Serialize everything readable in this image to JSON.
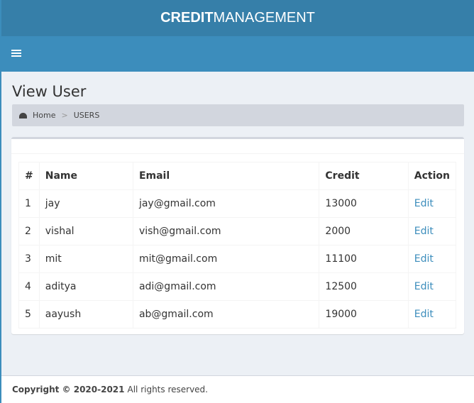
{
  "header": {
    "brand_bold": "CREDIT",
    "brand_rest": "MANAGEMENT"
  },
  "page": {
    "title": "View User"
  },
  "breadcrumb": {
    "home": "Home",
    "separator": ">",
    "current": "USERS"
  },
  "table": {
    "columns": [
      "#",
      "Name",
      "Email",
      "Credit",
      "Action"
    ],
    "rows": [
      {
        "id": "1",
        "name": "jay",
        "email": "jay@gmail.com",
        "credit": "13000",
        "action": "Edit"
      },
      {
        "id": "2",
        "name": "vishal",
        "email": "vish@gmail.com",
        "credit": "2000",
        "action": "Edit"
      },
      {
        "id": "3",
        "name": "mit",
        "email": "mit@gmail.com",
        "credit": "11100",
        "action": "Edit"
      },
      {
        "id": "4",
        "name": "aditya",
        "email": "adi@gmail.com",
        "credit": "12500",
        "action": "Edit"
      },
      {
        "id": "5",
        "name": "aayush",
        "email": "ab@gmail.com",
        "credit": "19000",
        "action": "Edit"
      }
    ]
  },
  "footer": {
    "copyright": "Copyright © 2020-2021",
    "rights": "All rights reserved."
  },
  "colors": {
    "header_dark": "#367fa9",
    "header": "#3c8dbc",
    "link": "#3c8dbc",
    "background": "#ecf0f5"
  },
  "icons": {
    "menu": "hamburger-icon",
    "dashboard": "dashboard-gauge-icon"
  }
}
